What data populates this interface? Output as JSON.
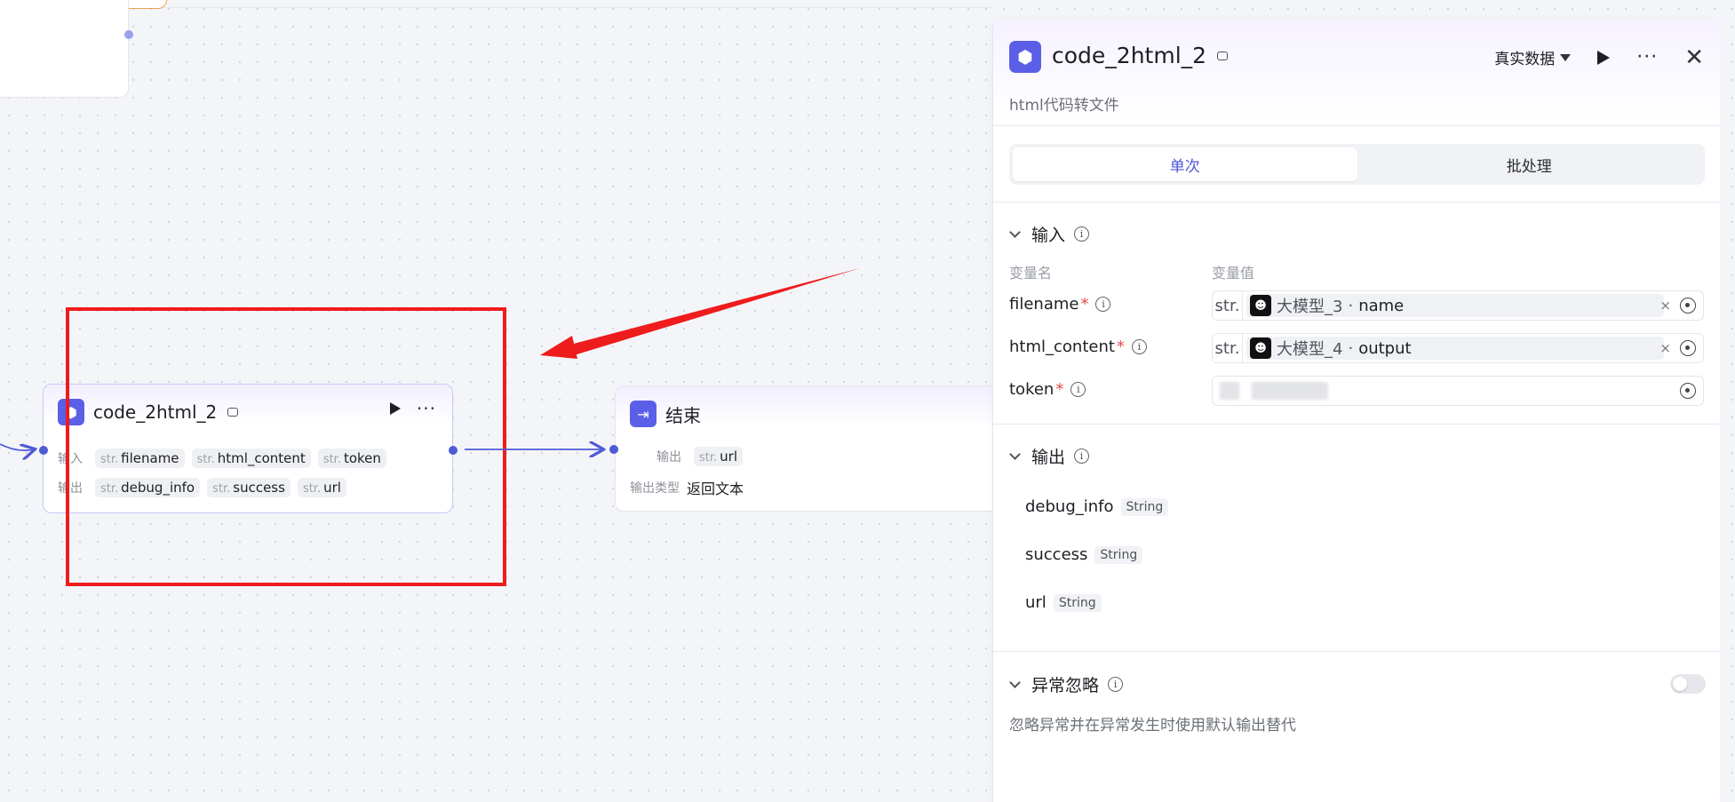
{
  "canvas": {
    "code_node": {
      "title": "code_2html_2",
      "input_label": "输入",
      "output_label": "输出",
      "inputs": [
        {
          "type": "str.",
          "name": "filename"
        },
        {
          "type": "str.",
          "name": "html_content"
        },
        {
          "type": "str.",
          "name": "token"
        }
      ],
      "outputs": [
        {
          "type": "str.",
          "name": "debug_info"
        },
        {
          "type": "str.",
          "name": "success"
        },
        {
          "type": "str.",
          "name": "url"
        }
      ]
    },
    "end_node": {
      "title": "结束",
      "output_label": "输出",
      "output_chip_type": "str.",
      "output_chip_name": "url",
      "output_type_label": "输出类型",
      "output_type_value": "返回文本"
    }
  },
  "panel": {
    "title": "code_2html_2",
    "description": "html代码转文件",
    "mode_label": "真实数据",
    "tabs": [
      "单次",
      "批处理"
    ],
    "input_section": {
      "title": "输入",
      "col_name": "变量名",
      "col_value": "变量值",
      "params": [
        {
          "name": "filename",
          "required": "*",
          "type": "str.",
          "source": "大模型_3",
          "field": "name"
        },
        {
          "name": "html_content",
          "required": "*",
          "type": "str.",
          "source": "大模型_4",
          "field": "output"
        },
        {
          "name": "token",
          "required": "*"
        }
      ],
      "separator": "·",
      "clear": "×"
    },
    "output_section": {
      "title": "输出",
      "items": [
        {
          "name": "debug_info",
          "type": "String"
        },
        {
          "name": "success",
          "type": "String"
        },
        {
          "name": "url",
          "type": "String"
        }
      ]
    },
    "ignore_section": {
      "title": "异常忽略",
      "description": "忽略异常并在异常发生时使用默认输出替代"
    }
  },
  "icons": {
    "node": "cube-icon",
    "end": "exit-icon",
    "bot": "bot-icon",
    "info": "info-icon"
  },
  "colors": {
    "accent": "#4e55d6",
    "node_icon": "#5b5fe8",
    "annotation_red": "#ee1c1c",
    "required": "#e5484d"
  }
}
